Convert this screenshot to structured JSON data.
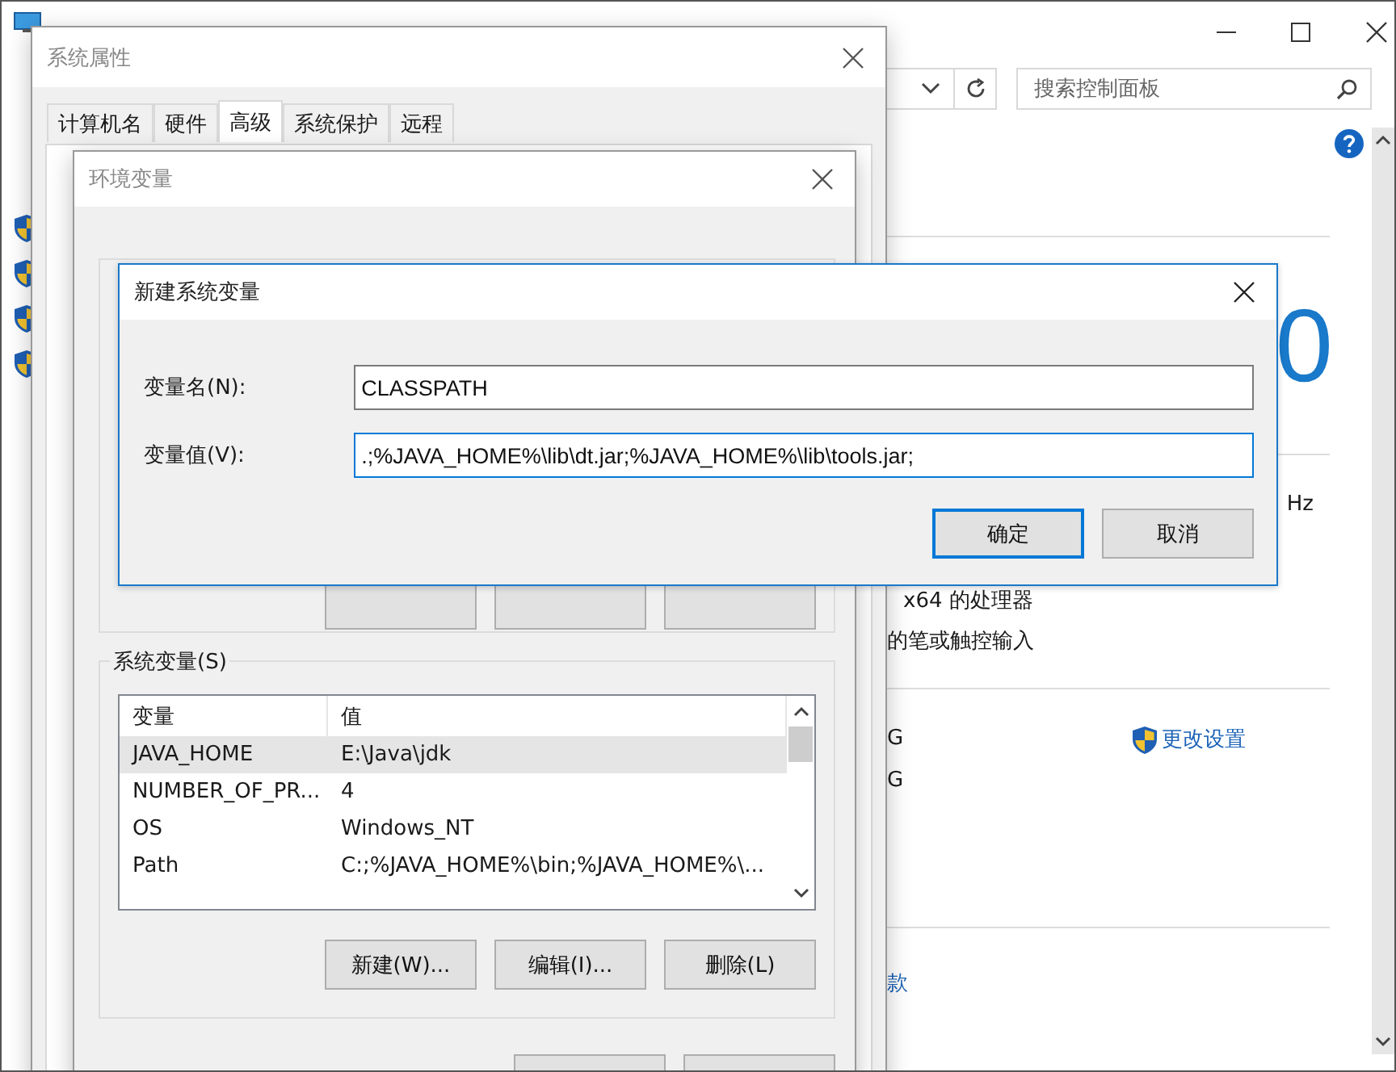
{
  "control_panel": {
    "search": {
      "placeholder": "搜索控制面板"
    },
    "edition_fragment": "0",
    "processor_speed_fragment": "Hz",
    "system_type_fragment": "x64 的处理器",
    "pen_fragment": "的笔或触控输入",
    "memory_fragments": [
      "G",
      "G"
    ],
    "change_settings_link": "更改设置",
    "bottom_fragment": "款"
  },
  "system_properties": {
    "title": "系统属性",
    "tabs": [
      {
        "label": "计算机名",
        "selected": false
      },
      {
        "label": "硬件",
        "selected": false
      },
      {
        "label": "高级",
        "selected": true
      },
      {
        "label": "系统保护",
        "selected": false
      },
      {
        "label": "远程",
        "selected": false
      }
    ]
  },
  "environment_variables": {
    "title": "环境变量",
    "system_variables": {
      "label": "系统变量(S)",
      "columns": [
        "变量",
        "值"
      ],
      "rows": [
        {
          "name": "JAVA_HOME",
          "value": "E:\\Java\\jdk",
          "selected": true
        },
        {
          "name": "NUMBER_OF_PR...",
          "value": "4",
          "selected": false
        },
        {
          "name": "OS",
          "value": "Windows_NT",
          "selected": false
        },
        {
          "name": "Path",
          "value": "C:;%JAVA_HOME%\\bin;%JAVA_HOME%\\...",
          "selected": false
        }
      ],
      "buttons": [
        "新建(W)...",
        "编辑(I)...",
        "删除(L)"
      ]
    }
  },
  "new_system_variable": {
    "title": "新建系统变量",
    "fields": [
      {
        "label": "变量名(N):",
        "value": "CLASSPATH",
        "focused": false
      },
      {
        "label": "变量值(V):",
        "value": ".;%JAVA_HOME%\\lib\\dt.jar;%JAVA_HOME%\\lib\\tools.jar;",
        "focused": true
      }
    ],
    "buttons": [
      {
        "label": "确定",
        "default": true
      },
      {
        "label": "取消",
        "default": false
      }
    ]
  }
}
